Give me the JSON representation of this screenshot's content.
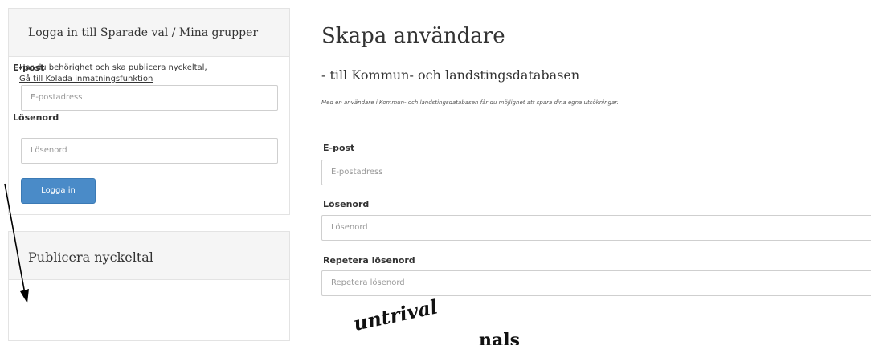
{
  "login": {
    "title": "Logga in till Sparade val / Mina grupper",
    "email_label": "E-post",
    "email_placeholder": "E-postadress",
    "password_label": "Lösenord",
    "password_placeholder": "Lösenord",
    "button_label": "Logga in"
  },
  "publish": {
    "title": "Publicera nyckeltal",
    "text": "Har du behörighet och ska publicera nyckeltal,",
    "link_label": "Gå till Kolada inmatningsfunktion"
  },
  "register": {
    "title": "Skapa användare",
    "subtitle": "- till Kommun- och landstingsdatabasen",
    "description": "Med en användare i Kommun- och landstingsdatabasen får du möjlighet att spara dina egna utsökningar.",
    "email_label": "E-post",
    "email_placeholder": "E-postadress",
    "password_label": "Lösenord",
    "password_placeholder": "Lösenord",
    "repeat_label": "Repetera lösenord",
    "repeat_placeholder": "Repetera lösenord"
  },
  "captcha": {
    "word1": "untrival",
    "word2": "nals"
  },
  "colors": {
    "primary_button": "#4a8bc8",
    "panel_heading_bg": "#f5f5f5"
  }
}
